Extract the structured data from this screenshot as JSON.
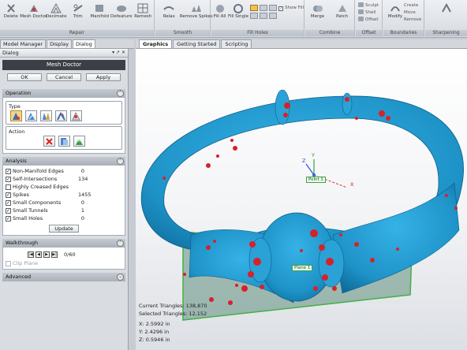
{
  "ribbon": {
    "groups": [
      {
        "title": "Repair",
        "tools": [
          "Delete",
          "Mesh Doctor",
          "Decimate",
          "Trim",
          "Manifold",
          "Defeature",
          "Remesh"
        ]
      },
      {
        "title": "Smooth",
        "tools": [
          "Relax",
          "Remove Spikes"
        ]
      },
      {
        "title": "Fill Holes",
        "tools": [
          "Fill All",
          "Fill Single"
        ],
        "option": "Show Fill"
      },
      {
        "title": "Combine",
        "tools": [
          "Merge",
          "Patch"
        ]
      },
      {
        "title": "Offset",
        "tools": [
          "Sculpt",
          "Shell",
          "Offset"
        ]
      },
      {
        "title": "Boundaries",
        "tools": [
          "Modify",
          "Create",
          "Move",
          "Remove"
        ]
      },
      {
        "title": "Sharpening",
        "tools": []
      }
    ]
  },
  "left_tabs": [
    "Model Manager",
    "Display",
    "Dialog"
  ],
  "dialog": {
    "header": "Dialog",
    "header_controls": "▾ ↗ ✕",
    "title": "Mesh Doctor",
    "ok": "OK",
    "cancel": "Cancel",
    "apply": "Apply",
    "operation": {
      "label": "Operation",
      "type_label": "Type",
      "action_label": "Action"
    },
    "analysis": {
      "label": "Analysis",
      "rows": [
        {
          "label": "Non-Manifold Edges",
          "checked": true,
          "value": "0"
        },
        {
          "label": "Self-Intersections",
          "checked": true,
          "value": "134"
        },
        {
          "label": "Highly Creased Edges",
          "checked": false,
          "value": ""
        },
        {
          "label": "Spikes",
          "checked": true,
          "value": "1455"
        },
        {
          "label": "Small Components",
          "checked": true,
          "value": "0"
        },
        {
          "label": "Small Tunnels",
          "checked": true,
          "value": "1"
        },
        {
          "label": "Small Holes",
          "checked": true,
          "value": "0"
        }
      ],
      "update": "Update"
    },
    "walkthrough": {
      "label": "Walkthrough",
      "counter": "0/60",
      "clip_plane": "Clip Plane"
    },
    "advanced": "Advanced"
  },
  "view_tabs": [
    "Graphics",
    "Getting Started",
    "Scripting"
  ],
  "viewport": {
    "point_label": "Point 1",
    "plane_label": "Plane 1",
    "axis_x": "X",
    "axis_y": "Y",
    "axis_z": "Z",
    "current_triangles": "Current Triangles: 138,870",
    "selected_triangles": "Selected Triangles: 12,152",
    "coord_x": "X:  2.5992 in",
    "coord_y": "Y:  2.4296 in",
    "coord_z": "Z:  0.5946 in"
  },
  "colors": {
    "mesh": "#1e93c8",
    "defect": "#d8202a",
    "plane": "#5e8f7e",
    "accent": "#f6d38a"
  }
}
